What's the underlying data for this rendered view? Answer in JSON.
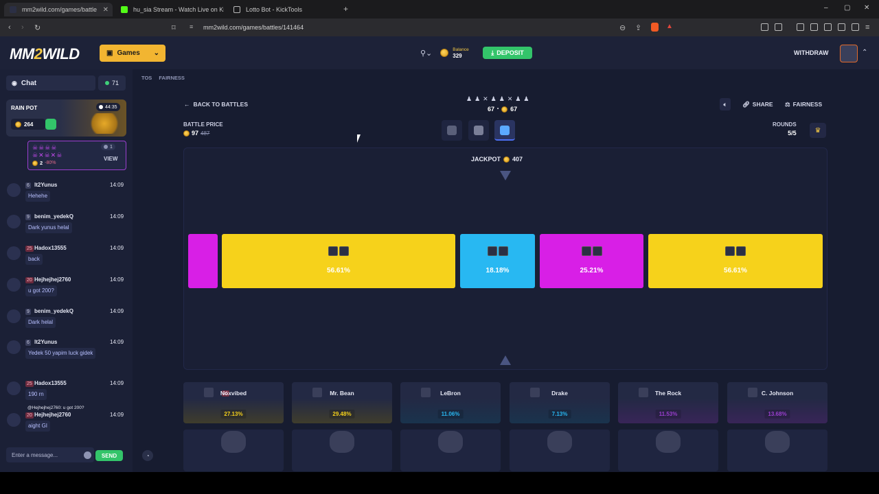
{
  "browser": {
    "tabs": [
      {
        "title": "mm2wild.com/games/battle",
        "active": true
      },
      {
        "title": "hu_sia Stream - Watch Live on Ki",
        "active": false
      },
      {
        "title": "Lotto Bot - KickTools",
        "active": false
      }
    ],
    "url": "mm2wild.com/games/battles/141464"
  },
  "header": {
    "logo_a": "MM",
    "logo_b": "2",
    "logo_c": "WILD",
    "games_label": "Games",
    "balance_label": "Balance",
    "balance_value": "329",
    "deposit_label": "DEPOSIT",
    "withdraw_label": "WITHDRAW"
  },
  "sidebar": {
    "chat_label": "Chat",
    "online_count": "71",
    "rain_pot_label": "RAIN POT",
    "rain_pot_timer": "44:35",
    "rain_pot_amount": "264",
    "raffle": {
      "count": "1",
      "amount": "2",
      "discount": "-80%",
      "view_label": "VIEW"
    },
    "messages": [
      {
        "level": "6",
        "name": "lt2Yunus",
        "time": "14:09",
        "text": "Hehehe"
      },
      {
        "level": "9",
        "name": "benim_yedekQ",
        "time": "14:09",
        "text": "Dark yunus helal"
      },
      {
        "level": "25",
        "name": "Hadox13555",
        "time": "14:09",
        "text": "back"
      },
      {
        "level": "20",
        "name": "Hejhejhej2760",
        "time": "14:09",
        "text": "u got 200?"
      },
      {
        "level": "9",
        "name": "benim_yedekQ",
        "time": "14:09",
        "text": "Dark helal"
      },
      {
        "level": "6",
        "name": "lt2Yunus",
        "time": "14:09",
        "text": "Yedek 50 yapim luck gidek"
      },
      {
        "level": "25",
        "name": "Hadox13555",
        "time": "14:09",
        "text": "190 rn"
      },
      {
        "level": "20",
        "name": "Hejhejhej2760",
        "time": "14:09",
        "text": "aight GI"
      }
    ],
    "reply_ref": "@Hejhejhej2760: u got 200?",
    "input_placeholder": "Enter a message...",
    "send_label": "SEND"
  },
  "main": {
    "tos": "TOS",
    "fairness_link": "FAIRNESS",
    "back_label": "BACK TO BATTLES",
    "team_score": "67",
    "team_score_b": "67",
    "battle_price_label": "BATTLE PRICE",
    "battle_price": "97",
    "battle_price_old": "487",
    "share_label": "SHARE",
    "fairness_label": "FAIRNESS",
    "rounds_label": "ROUNDS",
    "rounds_value": "5/5",
    "jackpot_label": "JACKPOT",
    "jackpot_value": "407",
    "slots": [
      {
        "pct": "56.61%",
        "color": "#f6d21b"
      },
      {
        "pct": "18.18%",
        "color": "#28b8f2"
      },
      {
        "pct": "25.21%",
        "color": "#d81fe6"
      },
      {
        "pct": "56.61%",
        "color": "#f6d21b"
      }
    ],
    "players": [
      {
        "name": "Noxvibed",
        "level": "25",
        "pct": "27.13%",
        "color": "#f6d21b"
      },
      {
        "name": "Mr. Bean",
        "pct": "29.48%",
        "color": "#f6d21b"
      },
      {
        "name": "LeBron",
        "pct": "11.06%",
        "color": "#28b8f2"
      },
      {
        "name": "Drake",
        "pct": "7.13%",
        "color": "#28b8f2"
      },
      {
        "name": "The Rock",
        "pct": "11.53%",
        "color": "#9b3fcf"
      },
      {
        "name": "C. Johnson",
        "pct": "13.68%",
        "color": "#9b3fcf"
      }
    ]
  }
}
